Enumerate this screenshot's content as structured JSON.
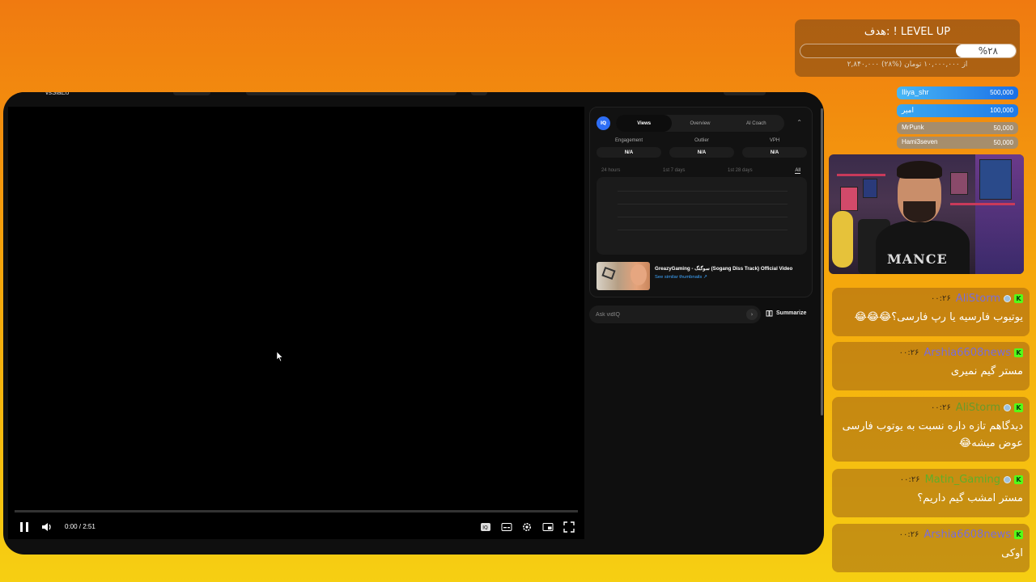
{
  "browser": {
    "logo_fragment": "vsSiaEo",
    "player": {
      "time": "0:00 / 2:51",
      "progress_fraction": 0.0,
      "icons": [
        "pause-icon",
        "volume-icon",
        "vidiq-icon",
        "subtitles-icon",
        "settings-icon",
        "miniplayer-icon",
        "fullscreen-icon"
      ]
    },
    "vidiq": {
      "badge": "IQ",
      "tabs": [
        "Views",
        "Overview",
        "AI Coach"
      ],
      "active_tab": "Views",
      "stats": [
        {
          "label": "Engagement",
          "value": "N/A"
        },
        {
          "label": "Outlier",
          "value": "N/A"
        },
        {
          "label": "VPH",
          "value": "N/A"
        }
      ],
      "ranges": [
        "24 hours",
        "1st 7 days",
        "1st 28 days",
        "All"
      ],
      "active_range": "All",
      "video_title": "GreazyGaming - سوگنگ (Sogang Diss Track) Official Video",
      "video_link": "See similar thumbnails ↗",
      "ask_placeholder": "Ask vidIQ",
      "summarize_label": "Summarize"
    }
  },
  "goal": {
    "title": "هدف: ! LEVEL UP",
    "percent_label": "%۲۸",
    "progress_fraction": 0.28,
    "subtitle": "۲,۸۴۰,۰۰۰ از ۱۰,۰۰۰,۰۰۰ تومان (%۲۸)"
  },
  "donors": [
    {
      "name": "Iliya_shr",
      "amount": "500,000"
    },
    {
      "name": "امیر",
      "amount": "100,000"
    },
    {
      "name": "MrPunk",
      "amount": "50,000"
    },
    {
      "name": "Hami3seven",
      "amount": "50,000"
    }
  ],
  "webcam": {
    "shirt_text": "MANCE"
  },
  "chat": [
    {
      "time": "۰۰:۲۶",
      "user": "AliStorm",
      "color": "#7a6cd8",
      "message": "یوتیوب فارسیه یا رپ فارسی؟😂😂😂"
    },
    {
      "time": "۰۰:۲۶",
      "user": "Arshia6608news",
      "color": "#7a6cd8",
      "message": "مستر گیم نمیری"
    },
    {
      "time": "۰۰:۲۶",
      "user": "AliStorm",
      "color": "#6a9a2a",
      "message": "دیدگاهم تازه داره نسبت به یوتوب فارسی عوض میشه😂"
    },
    {
      "time": "۰۰:۲۶",
      "user": "Matin_Gaming",
      "color": "#5fae2a",
      "message": "مستر امشب گیم داریم؟"
    },
    {
      "time": "۰۰:۲۶",
      "user": "Arshia6608news",
      "color": "#7a6cd8",
      "message": "اوکی"
    }
  ]
}
